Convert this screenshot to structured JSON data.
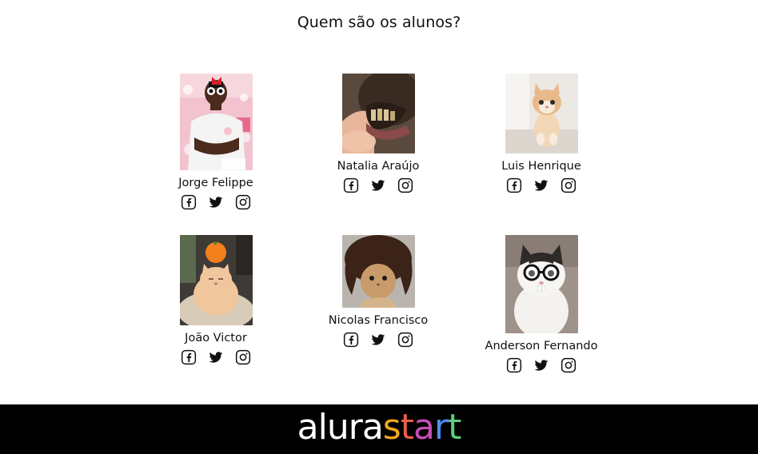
{
  "page": {
    "title": "Quem são os alunos?"
  },
  "students": [
    {
      "name": "Jorge Felippe"
    },
    {
      "name": "Natalia Araújo"
    },
    {
      "name": "Luis Henrique"
    },
    {
      "name": "João Victor"
    },
    {
      "name": "Nicolas Francisco"
    },
    {
      "name": "Anderson Fernando"
    }
  ],
  "social_icons": [
    "facebook-icon",
    "twitter-icon",
    "instagram-icon"
  ],
  "footer": {
    "brand_part1": "alura",
    "brand_part2_letters": [
      "s",
      "t",
      "a",
      "r",
      "t"
    ],
    "colors": {
      "background": "#000000",
      "brand_white": "#ffffff",
      "start_gradient": [
        "#f4a51c",
        "#ec5e4a",
        "#c74fb4",
        "#4e8ef0",
        "#5ccf78"
      ]
    }
  }
}
